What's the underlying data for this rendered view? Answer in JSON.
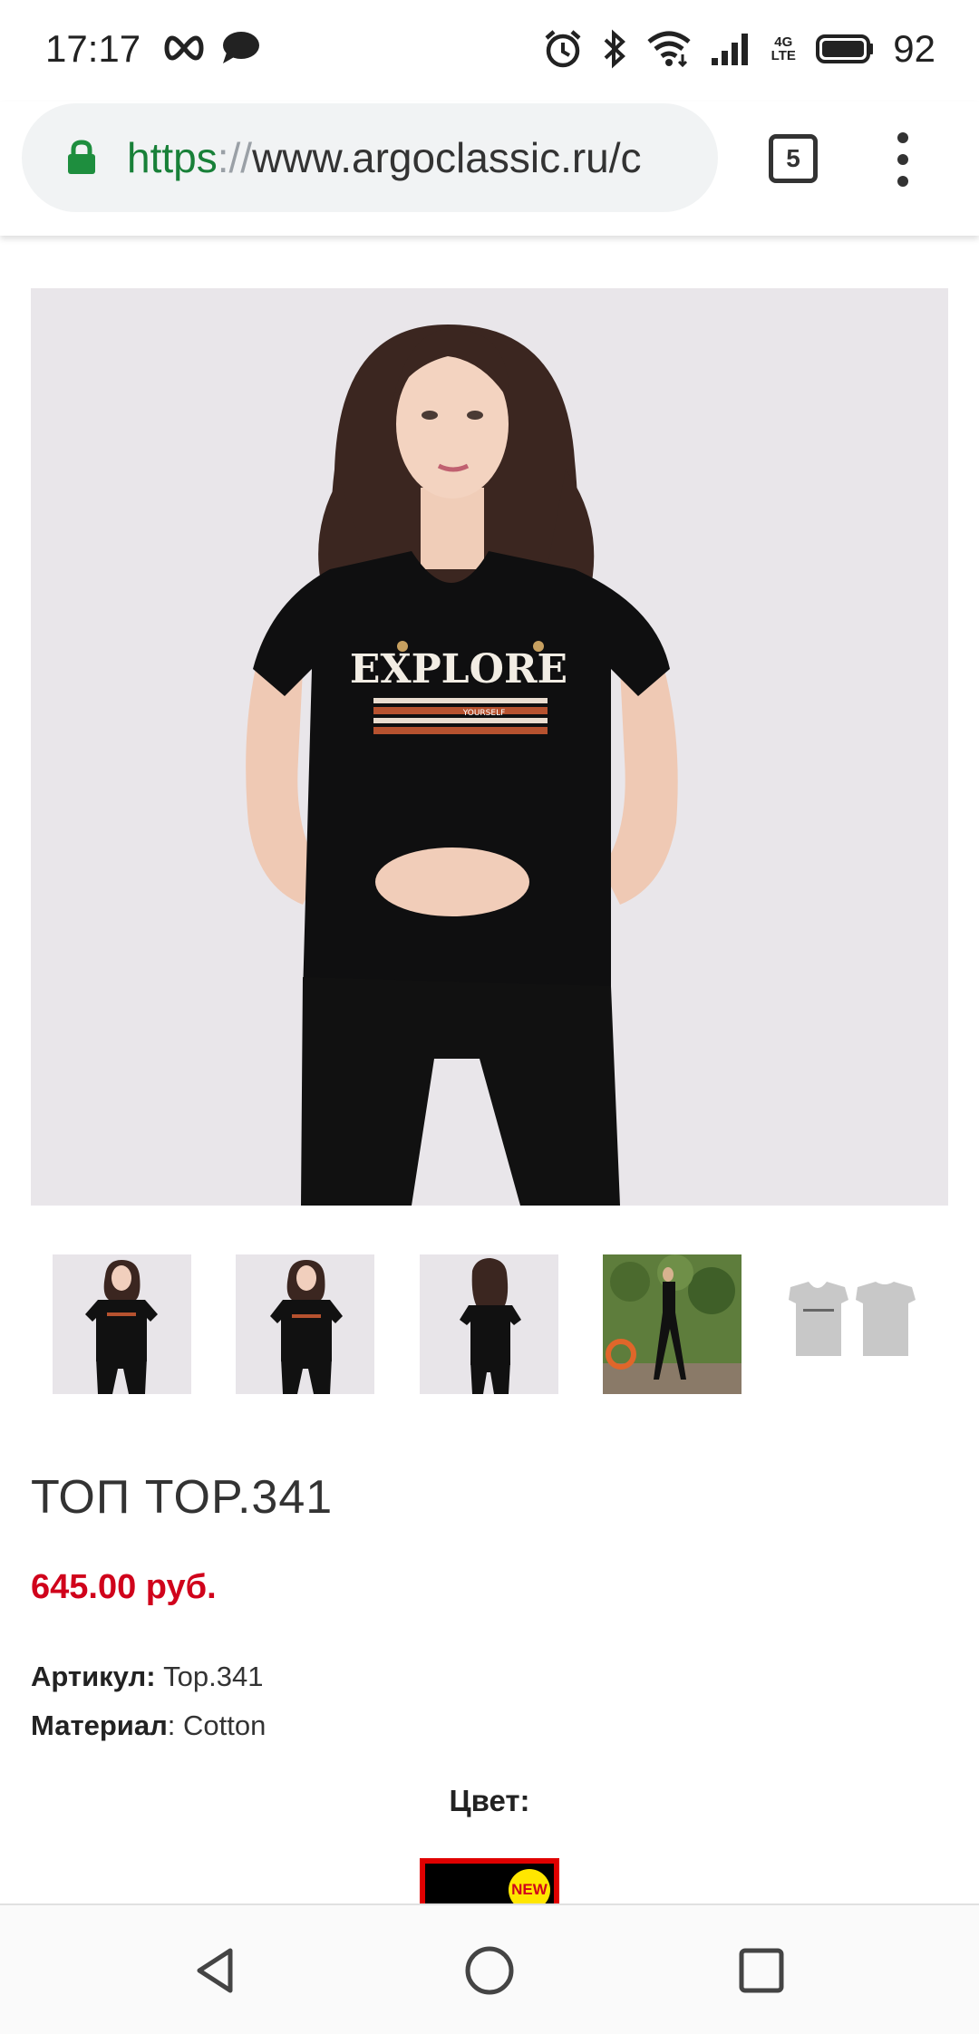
{
  "status_bar": {
    "time": "17:17",
    "battery": "92",
    "network_top": "4G",
    "network_bottom": "LTE",
    "icons": [
      "infinity-icon",
      "chat-bubble-icon",
      "alarm-icon",
      "bluetooth-icon",
      "wifi-icon",
      "signal-icon",
      "battery-icon"
    ]
  },
  "browser": {
    "url_scheme": "https",
    "url_separator": "://",
    "url_rest": "www.argoclassic.ru/c",
    "tab_count": "5",
    "secure_color": "#1e8e3e"
  },
  "gallery": {
    "main_image_alt": "EXPLORE",
    "print_sub": "YOURSELF",
    "thumbnails": [
      {
        "name": "thumb-front"
      },
      {
        "name": "thumb-front-2"
      },
      {
        "name": "thumb-back"
      },
      {
        "name": "thumb-outdoor"
      },
      {
        "name": "thumb-flat"
      }
    ]
  },
  "product": {
    "title": "ТОП TOP.341",
    "price": "645.00 руб.",
    "article_label": "Артикул:",
    "article_value": "Top.341",
    "material_label": "Материал",
    "material_value": ": Cotton",
    "color_heading": "Цвет:",
    "swatch_badge": "NEW",
    "price_color": "#d0021b"
  },
  "nav": {
    "icons": [
      "back-triangle-icon",
      "home-circle-icon",
      "recents-square-icon"
    ]
  }
}
